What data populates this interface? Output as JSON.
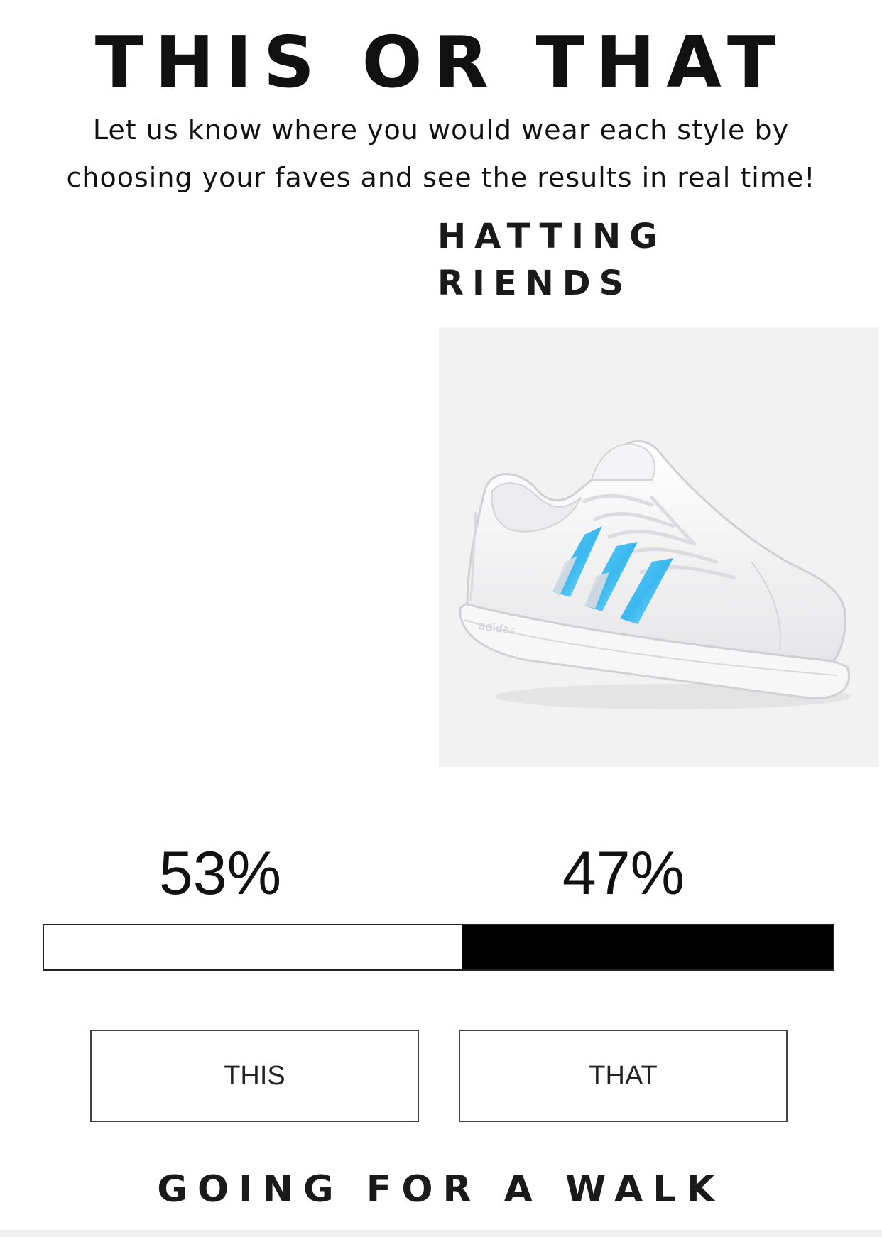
{
  "header": {
    "title": "THIS OR THAT",
    "subtitle": "Let us know where you would wear each style by choosing your faves and see the results in real time!"
  },
  "question": {
    "caption": "HATTING\nRIENDS"
  },
  "product": {
    "image": "white-sneaker-iridescent-stripes",
    "brand_marking": "adidas"
  },
  "results": {
    "this_percent_label": "53%",
    "that_percent_label": "47%",
    "this_percent": 53,
    "that_percent": 47,
    "bar_colors": {
      "this": "#ffffff",
      "that": "#000000"
    }
  },
  "buttons": {
    "this_label": "THIS",
    "that_label": "THAT"
  },
  "next_question": {
    "caption": "GOING FOR A WALK"
  }
}
